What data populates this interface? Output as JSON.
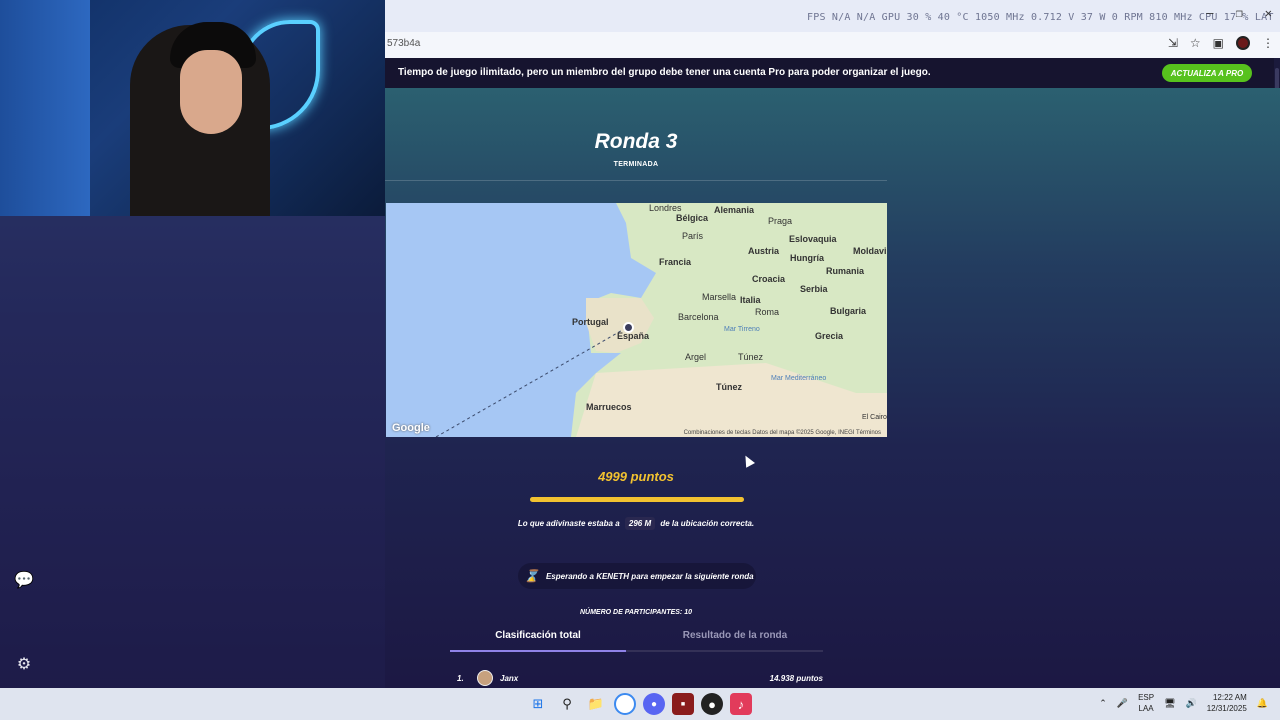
{
  "osd": {
    "stats": "FPS  N/A  N/A   GPU  30 %  40 °C  1050 MHz  0.712 V  37 W  0 RPM  810 MHz   CPU  17 %   LAT  N/A"
  },
  "browser": {
    "url": "573b4a"
  },
  "banner": {
    "text": "Tiempo de juego ilimitado, pero un miembro del grupo debe tener una cuenta Pro para poder organizar el juego.",
    "pro_button": "ACTUALIZA A PRO"
  },
  "round": {
    "title": "Ronda 3",
    "status": "TERMINADA"
  },
  "map": {
    "labels": {
      "londres": "Londres",
      "belgica": "Bélgica",
      "alemania": "Alemania",
      "praga": "Praga",
      "paris": "París",
      "eslovaquia": "Eslovaquia",
      "austria": "Austria",
      "moldavia": "Moldavi",
      "francia": "Francia",
      "hungria": "Hungría",
      "croacia": "Croacia",
      "rumania": "Rumania",
      "serbia": "Serbia",
      "marsella": "Marsella",
      "italia": "Italia",
      "roma": "Roma",
      "bulgaria": "Bulgaria",
      "portugal": "Portugal",
      "barcelona": "Barcelona",
      "mar_tirreno": "Mar Tirreno",
      "espana": "España",
      "grecia": "Grecia",
      "argel": "Argel",
      "tunez_city": "Túnez",
      "tunez": "Túnez",
      "mar_mediterraneo": "Mar Mediterráneo",
      "marruecos": "Marruecos",
      "el_cairo": "El Cairo"
    },
    "google": "Google",
    "attribution": "Combinaciones de teclas   Datos del mapa ©2025 Google, INEGI   Términos"
  },
  "result": {
    "points": "4999 puntos",
    "progress_fraction": 0.9998,
    "distance_prefix": "Lo que adivinaste estaba a",
    "distance_value": "296 M",
    "distance_suffix": "de la ubicación correcta."
  },
  "waiting": {
    "text": "Esperando a KENETH para empezar la siguiente ronda"
  },
  "participants": "NÚMERO DE PARTICIPANTES: 10",
  "tabs": {
    "total": "Clasificación total",
    "round": "Resultado de la ronda"
  },
  "leaderboard": [
    {
      "rank": "1.",
      "name": "Janx",
      "points": "14.938 puntos"
    }
  ],
  "taskbar": {
    "lang_top": "ESP",
    "lang_bottom": "LAA",
    "time": "12:22 AM",
    "date": "12/31/2025"
  }
}
